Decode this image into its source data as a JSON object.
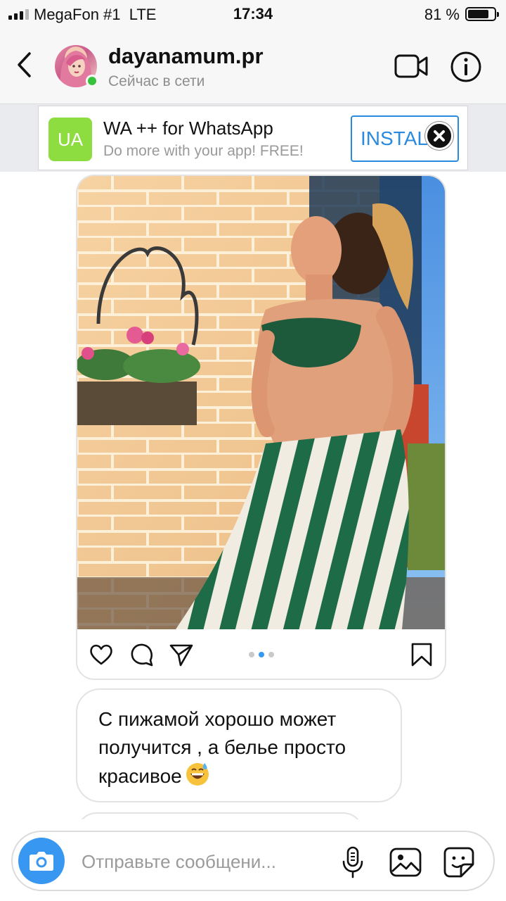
{
  "status_bar": {
    "carrier": "MegaFon #1",
    "network": "LTE",
    "time": "17:34",
    "battery_percent": "81 %",
    "battery_level": 0.81
  },
  "header": {
    "username": "dayanamum.pr",
    "presence": "Сейчас в сети",
    "icons": [
      "chevron-left-icon",
      "video-camera-icon",
      "info-icon"
    ]
  },
  "ad": {
    "logo_text": "UA",
    "title": "WA ++ for WhatsApp",
    "subtitle": "Do more with your app! FREE!",
    "install_label": "INSTALL",
    "colors": {
      "logo": "#8edd40",
      "accent": "#2a8ae0"
    }
  },
  "chat": {
    "shared_post": {
      "carousel_total": 3,
      "carousel_active_index": 1,
      "icons": [
        "heart-icon",
        "comment-icon",
        "share-icon",
        "bookmark-icon"
      ]
    },
    "messages": [
      {
        "text": "С пижамой хорошо может получится , а белье просто красивое",
        "emoji": "grinning-sweat-emoji"
      }
    ]
  },
  "composer": {
    "placeholder": "Отправьте сообщени...",
    "icons": [
      "camera-icon",
      "microphone-icon",
      "gallery-icon",
      "sticker-icon"
    ],
    "accent": "#3897f0"
  }
}
